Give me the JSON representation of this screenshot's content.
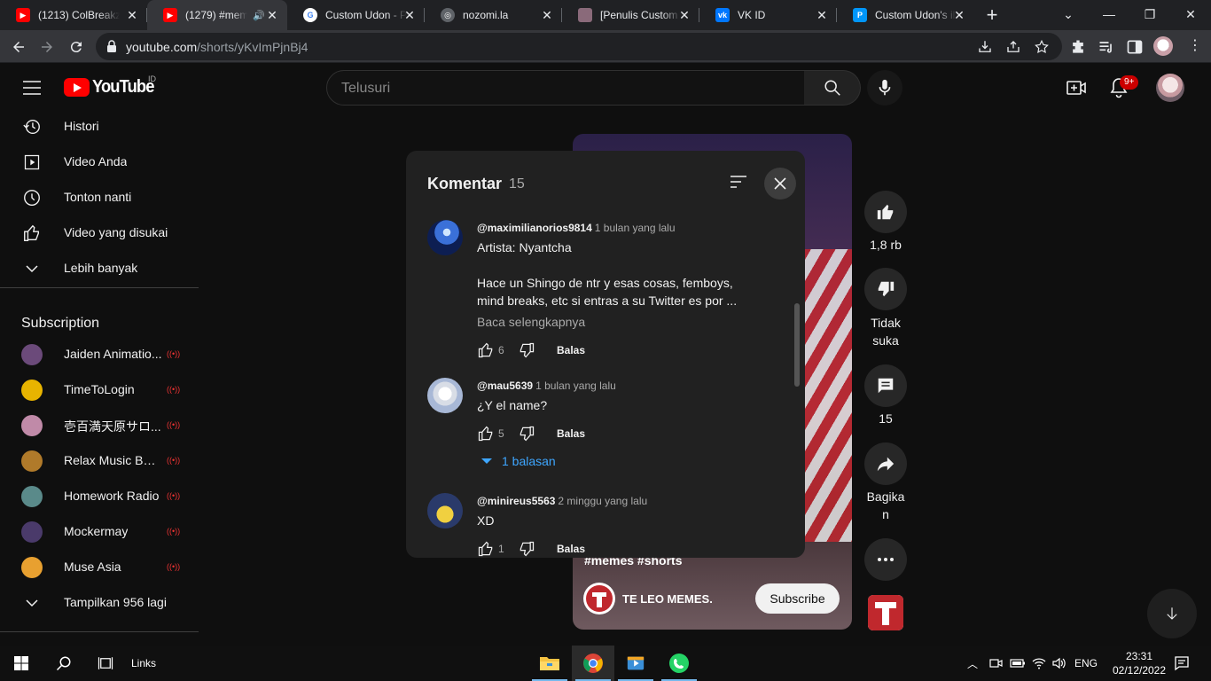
{
  "browser": {
    "tabs": [
      {
        "title": "(1213) ColBreakz",
        "favicon": "youtube",
        "active": false
      },
      {
        "title": "(1279) #mem",
        "favicon": "youtube",
        "active": true
      },
      {
        "title": "Custom Udon - P",
        "favicon": "google",
        "active": false
      },
      {
        "title": "nozomi.la",
        "favicon": "globe",
        "active": false
      },
      {
        "title": "[Penulis Custom",
        "favicon": "image",
        "active": false
      },
      {
        "title": "VK ID",
        "favicon": "vk",
        "active": false
      },
      {
        "title": "Custom Udon's il",
        "favicon": "pixiv",
        "active": false
      }
    ],
    "url_host": "youtube.com",
    "url_path": "/shorts/yKvImPjnBj4"
  },
  "masthead": {
    "logo_text": "YouTube",
    "country_code": "ID",
    "search_placeholder": "Telusuri",
    "notification_badge": "9+"
  },
  "sidebar": {
    "items": [
      {
        "label": "Histori",
        "icon": "history-icon"
      },
      {
        "label": "Video Anda",
        "icon": "play-square-icon"
      },
      {
        "label": "Tonton nanti",
        "icon": "clock-icon"
      },
      {
        "label": "Video yang disukai",
        "icon": "thumb-up-icon"
      },
      {
        "label": "Lebih banyak",
        "icon": "chevron-down-icon"
      }
    ],
    "subscriptions_title": "Subscription",
    "subscriptions": [
      {
        "name": "Jaiden Animatio...",
        "color": "#6b4a7a",
        "live": "((•))"
      },
      {
        "name": "TimeToLogin",
        "color": "#e8b400",
        "live": "((•))"
      },
      {
        "name": "壱百満天原サロ...",
        "color": "#c08aa8",
        "live": "((•))"
      },
      {
        "name": "Relax Music BG...",
        "color": "#b07a2a",
        "live": "((•))"
      },
      {
        "name": "Homework Radio",
        "color": "#5a8a8a",
        "live": "((•))"
      },
      {
        "name": "Mockermay",
        "color": "#4a3a6a",
        "live": "((•))"
      },
      {
        "name": "Muse Asia",
        "color": "#e8a030",
        "live": "((•))"
      }
    ],
    "show_more": "Tampilkan 956 lagi"
  },
  "short": {
    "hashtags": "#memes #shorts",
    "channel": "TE LEO MEMES.",
    "subscribe": "Subscribe",
    "likes": "1,8 rb",
    "dislike": "Tidak suka",
    "comments_count": "15",
    "share": "Bagikan"
  },
  "comments": {
    "title": "Komentar",
    "count": "15",
    "items": [
      {
        "author": "@maximilianorios9814",
        "time": "1 bulan yang lalu",
        "text_line1": "Artista: Nyantcha",
        "text_line2": "Hace un Shingo de ntr y esas cosas, femboys,",
        "text_line3": "mind breaks, etc si entras a su Twitter es por ...",
        "read_more": "Baca selengkapnya",
        "likes": "6",
        "reply": "Balas"
      },
      {
        "author": "@mau5639",
        "time": "1 bulan yang lalu",
        "text": "¿Y el name?",
        "likes": "5",
        "reply": "Balas",
        "replies": "1 balasan"
      },
      {
        "author": "@minireus5563",
        "time": "2 minggu yang lalu",
        "text": "XD",
        "likes": "1",
        "reply": "Balas"
      }
    ]
  },
  "taskbar": {
    "links": "Links",
    "lang": "ENG",
    "time": "23:31",
    "date": "02/12/2022"
  }
}
